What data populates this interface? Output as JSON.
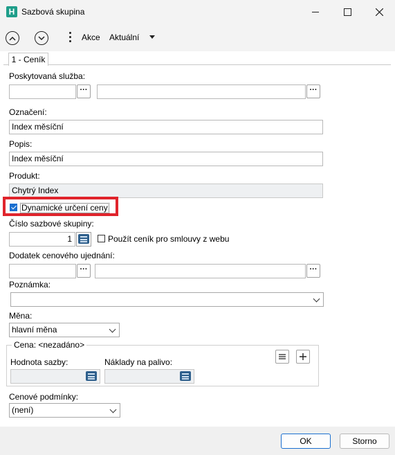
{
  "window": {
    "title": "Sazbová skupina",
    "app_icon_letter": "H"
  },
  "toolbar": {
    "akce_label": "Akce",
    "aktualni_label": "Aktuální"
  },
  "tab": {
    "label": "1 - Ceník"
  },
  "form": {
    "poskytovana_sluzba": {
      "label": "Poskytovaná služba:",
      "value1": "",
      "value2": ""
    },
    "oznaceni": {
      "label": "Označení:",
      "value": "Index měsíční"
    },
    "popis": {
      "label": "Popis:",
      "value": "Index měsíční"
    },
    "produkt": {
      "label": "Produkt:",
      "value": "Chytrý Index"
    },
    "dynamicke_urceni": {
      "label": "Dynamické určení ceny",
      "checked": true
    },
    "cislo_sazbove_skupiny": {
      "label": "Číslo sazbové skupiny:",
      "value": "1"
    },
    "pouzit_cenik": {
      "label": "Použít ceník pro smlouvy z webu",
      "checked": false
    },
    "dodatek": {
      "label": "Dodatek cenového ujednání:",
      "value1": "",
      "value2": ""
    },
    "poznamka": {
      "label": "Poznámka:",
      "value": ""
    },
    "mena": {
      "label": "Měna:",
      "value": "hlavní měna"
    },
    "cena": {
      "label": "Cena:",
      "status": "<nezadáno>"
    },
    "hodnota_sazby": {
      "label": "Hodnota sazby:",
      "value": ""
    },
    "naklady_na_palivo": {
      "label": "Náklady na palivo:",
      "value": ""
    },
    "cenove_podminky": {
      "label": "Cenové podmínky:",
      "value": "(není)"
    }
  },
  "buttons": {
    "ok": "OK",
    "storno": "Storno"
  },
  "colors": {
    "accent": "#1a6fd0",
    "highlight": "#e0242c"
  }
}
